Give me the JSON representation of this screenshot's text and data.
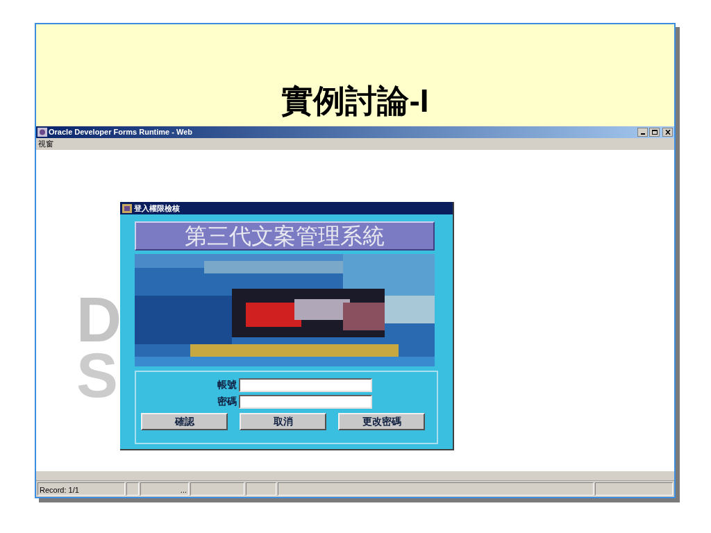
{
  "slide": {
    "title": "實例討論-I"
  },
  "window": {
    "title": "Oracle Developer Forms Runtime - Web",
    "menu": [
      "視窗"
    ],
    "background_text": [
      "D",
      "S"
    ]
  },
  "dialog": {
    "title": "登入權限檢核",
    "banner": "第三代文案管理系統",
    "fields": [
      {
        "label": "帳號"
      },
      {
        "label": "密碼"
      }
    ],
    "buttons": [
      "確認",
      "取消",
      "更改密碼"
    ]
  },
  "status_bar": [
    "Record: 1/1",
    "..."
  ]
}
